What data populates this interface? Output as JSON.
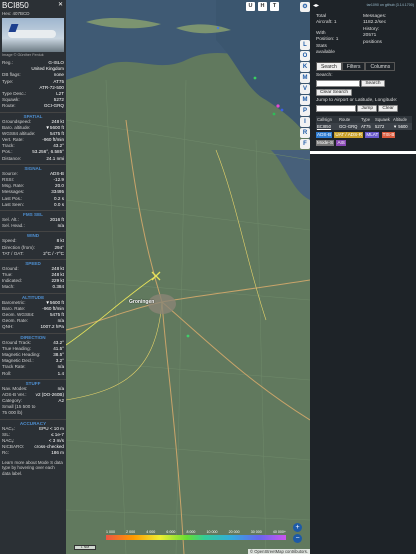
{
  "info": {
    "callsign": "BCI850",
    "hex_label": "Hex:",
    "hex": "407BCD",
    "close": "✕",
    "photo_credit": "Image © Günther Feniuk",
    "rows1": [
      {
        "k": "Reg.:",
        "v": "G-ISLO"
      },
      {
        "k": "",
        "v": "United Kingdom"
      },
      {
        "k": "DB flags:",
        "v": "none"
      },
      {
        "k": "Type:",
        "v": "AT75"
      },
      {
        "k": "",
        "v": "ATR-72-500"
      },
      {
        "k": "Type Desc.:",
        "v": "L2T"
      },
      {
        "k": "Squawk:",
        "v": "5272"
      },
      {
        "k": "Route:",
        "v": "GCI-GRQ"
      }
    ],
    "spatial_title": "SPATIAL",
    "spatial": [
      {
        "k": "Groundspeed:",
        "v": "248 kt"
      },
      {
        "k": "Baro. altitude:",
        "v": "▼5600 ft"
      },
      {
        "k": "WGS84 altitude:",
        "v": "5475 ft"
      },
      {
        "k": "Vert. Rate:",
        "v": "-960 ft/min"
      },
      {
        "k": "Track:",
        "v": "43.2°"
      },
      {
        "k": "Pos.:",
        "v": "53.256°, 6.585°"
      },
      {
        "k": "Distance:",
        "v": "24.1 nmi"
      }
    ],
    "signal_title": "SIGNAL",
    "signal": [
      {
        "k": "Source:",
        "v": "ADS-B"
      },
      {
        "k": "RSSI:",
        "v": "-12.9"
      },
      {
        "k": "Msg. Rate:",
        "v": "20.0"
      },
      {
        "k": "Messages:",
        "v": "33495"
      },
      {
        "k": "Last Pos.:",
        "v": "0.2 s"
      },
      {
        "k": "Last Seen:",
        "v": "0.0 s"
      }
    ],
    "fms_title": "FMS SEL",
    "fms": [
      {
        "k": "Sel. Alt.:",
        "v": "2016 ft"
      },
      {
        "k": "Sel. Head.:",
        "v": "n/a"
      }
    ],
    "wind_title": "WIND",
    "wind": [
      {
        "k": "Speed:",
        "v": "8 kt"
      },
      {
        "k": "Direction (from):",
        "v": "294°"
      },
      {
        "k": "TAT / OAT:",
        "v": "2°C / -7°C"
      }
    ],
    "speed_title": "SPEED",
    "speed": [
      {
        "k": "Ground:",
        "v": "248 kt"
      },
      {
        "k": "True:",
        "v": "248 kt"
      },
      {
        "k": "Indicated:",
        "v": "229 kt"
      },
      {
        "k": "Mach:",
        "v": "0.384"
      }
    ],
    "altitude_title": "ALTITUDE",
    "altitude": [
      {
        "k": "Barometric:",
        "v": "▼5600 ft"
      },
      {
        "k": "Baro. Rate:",
        "v": "-960 ft/min"
      },
      {
        "k": "Geom. WGS84:",
        "v": "5475 ft"
      },
      {
        "k": "Geom. Rate:",
        "v": "n/a"
      },
      {
        "k": "QNH:",
        "v": "1007.2 hPa"
      }
    ],
    "direction_title": "DIRECTION",
    "direction": [
      {
        "k": "Ground Track:",
        "v": "43.2°"
      },
      {
        "k": "True Heading:",
        "v": "41.5°"
      },
      {
        "k": "Magnetic Heading:",
        "v": "38.5°"
      },
      {
        "k": "Magnetic Decl.:",
        "v": "3.2°"
      },
      {
        "k": "Track Rate:",
        "v": "n/a"
      },
      {
        "k": "Roll:",
        "v": "1.4"
      }
    ],
    "stuff_title": "STUFF",
    "stuff": [
      {
        "k": "Nav. Modes:",
        "v": "n/a"
      },
      {
        "k": "ADS-B Ver.:",
        "v": "v2 (DO-260B)"
      },
      {
        "k": "Category:",
        "v": "A2"
      },
      {
        "k": "Small (15 500 to",
        "v": ""
      },
      {
        "k": "75 000 lb)",
        "v": ""
      }
    ],
    "accuracy_title": "ACCURACY",
    "accuracy": [
      {
        "k": "NACₚ:",
        "v": "EPU < 10 m"
      },
      {
        "k": "SIL:",
        "v": "≤ 1e-7"
      },
      {
        "k": "NACᵥ:",
        "v": "< 3 m/s"
      },
      {
        "k": "NICBARO:",
        "v": "cross-checked"
      },
      {
        "k": "Rc:",
        "v": "186 m"
      }
    ],
    "footer": "Learn more about Mode S data type by hovering over each data label."
  },
  "map": {
    "city": "Groningen",
    "top_buttons": [
      "U",
      "H",
      "T"
    ],
    "side_buttons": [
      "L",
      "O",
      "K",
      "M",
      "V",
      "M",
      "P",
      "I",
      "R",
      "F"
    ],
    "scale_label": "1 NM",
    "alt_ticks": [
      "1 000",
      "2 000",
      "4 000",
      "6 000",
      "8 000",
      "10 000",
      "20 000",
      "30 000",
      "40 000+"
    ],
    "attribution": "© OpenStreetMap contributors.",
    "zoom_in": "+",
    "zoom_out": "−"
  },
  "side": {
    "collapse": "◂▸",
    "version": "tar1090 on github (3.14.1700)",
    "total_aircraft_label": "Total Aircraft:",
    "total_aircraft": "1",
    "with_position_label": "With Position:",
    "with_position": "1",
    "stats_available": "Stats available",
    "messages_label": "Messages:",
    "messages": "1182.2/sec",
    "history_label": "History:",
    "history": "20571 positions",
    "tabs": [
      "Search",
      "Filters",
      "Columns"
    ],
    "search_label": "Search:",
    "search_button": "Search",
    "clear_search_button": "Clear Search",
    "jump_label": "Jump to Airport or Latitude, Longitude:",
    "jump_button": "Jump",
    "clear_button": "Clear",
    "table_headers": [
      "Callsign",
      "Route",
      "Type",
      "Squawk",
      "Altitude"
    ],
    "table_rows": [
      {
        "callsign": "BCI850",
        "route": "GCI-GRQ",
        "type": "AT75",
        "squawk": "5272",
        "altitude": "▼ 5600"
      }
    ],
    "badges": [
      "ADS-B",
      "UAT / ADS-R",
      "MLAT",
      "TIS-B",
      "Mode-S",
      "AIS"
    ],
    "badge_colors": [
      "#2e7bcf",
      "#c9a12b",
      "#6a5acd",
      "#d95b3e",
      "#777777",
      "#8a4bb5"
    ]
  }
}
